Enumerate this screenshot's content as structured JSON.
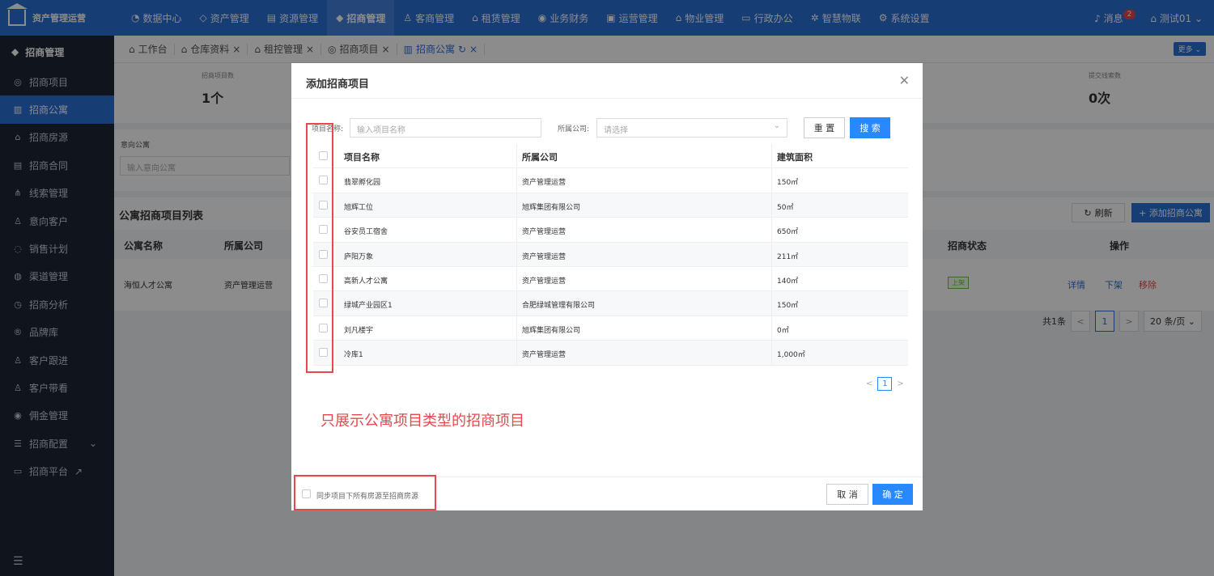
{
  "app": {
    "title": "资产管理运营"
  },
  "nav": [
    "数据中心",
    "资产管理",
    "资源管理",
    "招商管理",
    "客商管理",
    "租赁管理",
    "业务财务",
    "运营管理",
    "物业管理",
    "行政办公",
    "智慧物联",
    "系统设置"
  ],
  "top_right": {
    "messages": "消息",
    "badge": "2",
    "user": "测试01"
  },
  "sidebar": {
    "header": "招商管理",
    "items": [
      "招商项目",
      "招商公寓",
      "招商房源",
      "招商合同",
      "线索管理",
      "意向客户",
      "销售计划",
      "渠道管理",
      "招商分析",
      "品牌库",
      "客户跟进",
      "客户带看",
      "佣金管理",
      "招商配置",
      "招商平台"
    ]
  },
  "tabs": [
    "工作台",
    "仓库资料",
    "租控管理",
    "招商项目",
    "招商公寓"
  ],
  "more": "更多",
  "stats": {
    "left_label": "招商项目数",
    "left_value": "1个",
    "right_label": "提交线索数",
    "right_value": "0次"
  },
  "filter": {
    "label": "意向公寓",
    "placeholder": "输入意向公寓"
  },
  "list": {
    "title": "公寓招商项目列表",
    "refresh": "刷新",
    "add": "+ 添加招商公寓",
    "headers": {
      "name": "公寓名称",
      "company": "所属公司",
      "status": "招商状态",
      "ops": "操作"
    },
    "row": {
      "name": "海恒人才公寓",
      "company": "资产管理运营",
      "status": "上架",
      "detail": "详情",
      "down": "下架",
      "remove": "移除"
    },
    "pager": {
      "total": "共1条",
      "page": "1",
      "size": "20 条/页"
    }
  },
  "modal": {
    "title": "添加招商项目",
    "query": {
      "name_label": "项目名称:",
      "name_placeholder": "输入项目名称",
      "company_label": "所属公司:",
      "company_placeholder": "请选择",
      "reset": "重 置",
      "search": "搜 索"
    },
    "headers": {
      "name": "项目名称",
      "company": "所属公司",
      "area": "建筑面积"
    },
    "rows": [
      {
        "name": "翡翠孵化园",
        "company": "资产管理运营",
        "area": "150㎡"
      },
      {
        "name": "旭辉工位",
        "company": "旭辉集团有限公司",
        "area": "50㎡"
      },
      {
        "name": "谷安员工宿舍",
        "company": "资产管理运营",
        "area": "650㎡"
      },
      {
        "name": "庐阳万象",
        "company": "资产管理运营",
        "area": "211㎡"
      },
      {
        "name": "高新人才公寓",
        "company": "资产管理运营",
        "area": "140㎡"
      },
      {
        "name": "绿城产业园区1",
        "company": "合肥绿城管理有限公司",
        "area": "150㎡"
      },
      {
        "name": "刘凡楼宇",
        "company": "旭辉集团有限公司",
        "area": "0㎡"
      },
      {
        "name": "冷库1",
        "company": "资产管理运营",
        "area": "1,000㎡"
      }
    ],
    "page": "1",
    "annotation": "只展示公寓项目类型的招商项目",
    "sync_label": "同步项目下所有房源至招商房源",
    "cancel": "取 消",
    "confirm": "确 定"
  },
  "colors": {
    "primary": "#2a6fd6",
    "sidebar": "#1c2535",
    "annotation": "#e5484d"
  }
}
